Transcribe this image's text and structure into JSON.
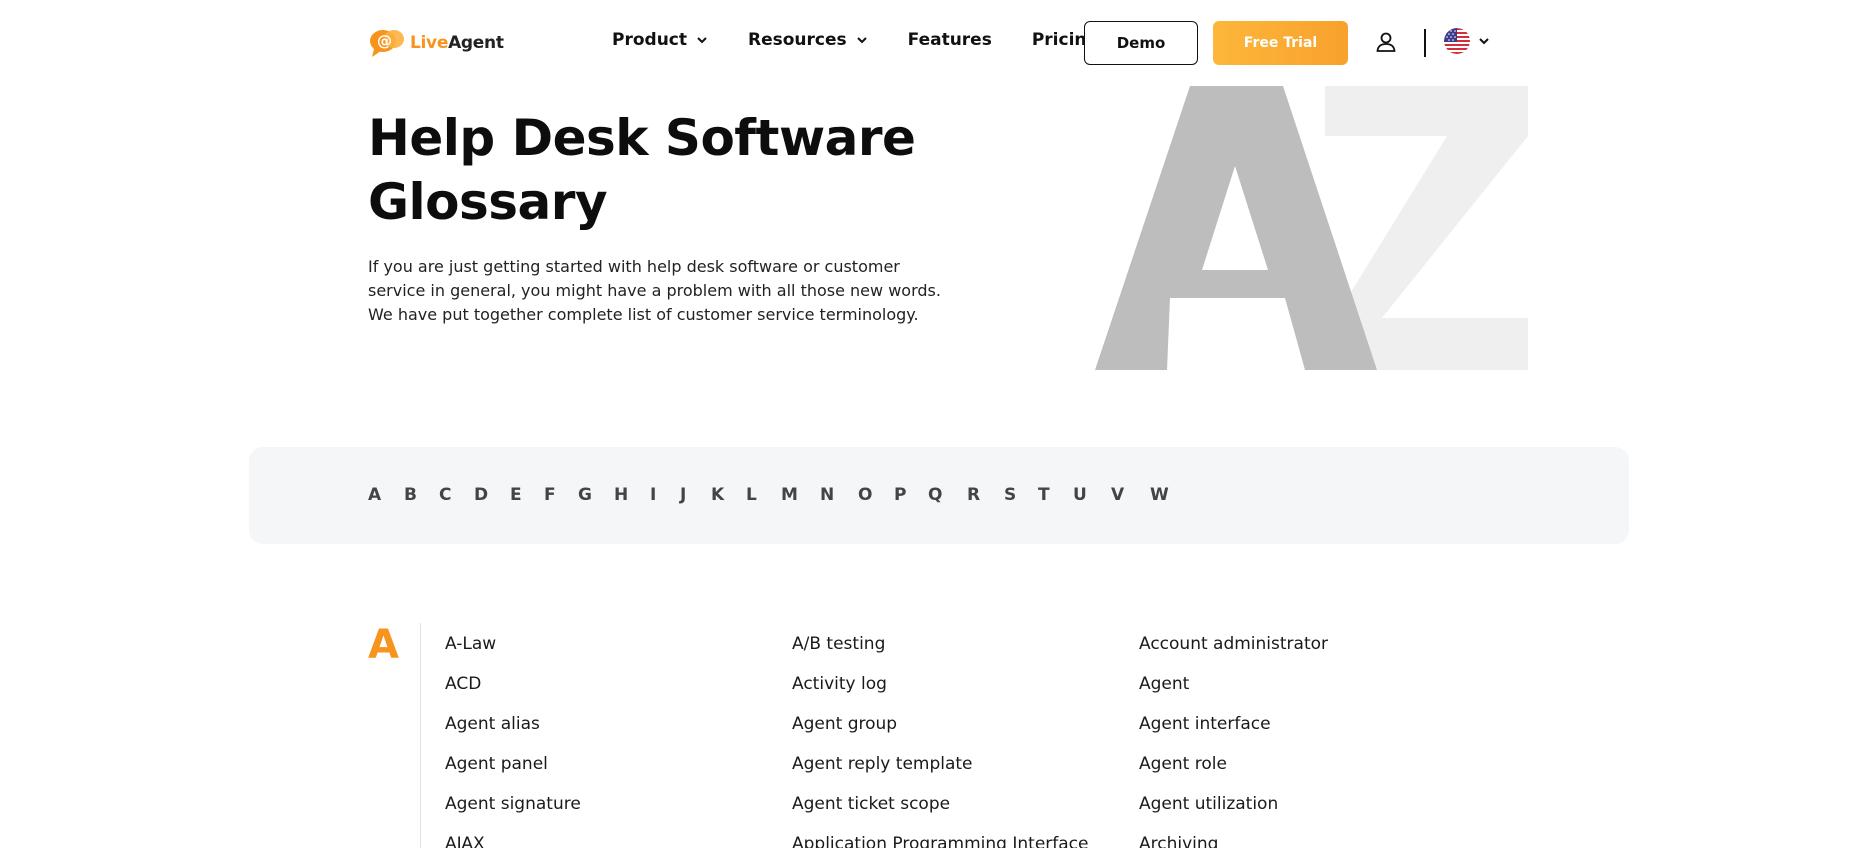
{
  "header": {
    "logo": {
      "part1": "Live",
      "part2": "Agent"
    },
    "nav": [
      {
        "label": "Product",
        "has_dropdown": true
      },
      {
        "label": "Resources",
        "has_dropdown": true
      },
      {
        "label": "Features",
        "has_dropdown": false
      },
      {
        "label": "Pricing",
        "has_dropdown": false
      }
    ],
    "demo_label": "Demo",
    "trial_label": "Free Trial",
    "user_icon": "user-icon",
    "language_icon": "us-flag-icon"
  },
  "hero": {
    "title_line1": "Help Desk Software",
    "title_line2": "Glossary",
    "description": "If you are just getting started with help desk software or customer service in general, you might have a problem with all those new words. We have put together complete list of customer service terminology.",
    "art_letters": [
      "A",
      "Z"
    ]
  },
  "alphabet": [
    "A",
    "B",
    "C",
    "D",
    "E",
    "F",
    "G",
    "H",
    "I",
    "J",
    "K",
    "L",
    "M",
    "N",
    "O",
    "P",
    "Q",
    "R",
    "S",
    "T",
    "U",
    "V",
    "W"
  ],
  "glossary": {
    "section_letter": "A",
    "terms": [
      "A-Law",
      "A/B testing",
      "Account administrator",
      "ACD",
      "Activity log",
      "Agent",
      "Agent alias",
      "Agent group",
      "Agent interface",
      "Agent panel",
      "Agent reply template",
      "Agent role",
      "Agent signature",
      "Agent ticket scope",
      "Agent utilization",
      "AJAX",
      "Application Programming Interface",
      "Archiving"
    ]
  },
  "colors": {
    "accent": "#f7941d",
    "trial_gradient_start": "#fdb73a",
    "trial_gradient_end": "#f8a12d",
    "alpha_bar_bg": "#f5f6f8",
    "art_a": "#bdbdbd",
    "art_z": "#efefef"
  }
}
